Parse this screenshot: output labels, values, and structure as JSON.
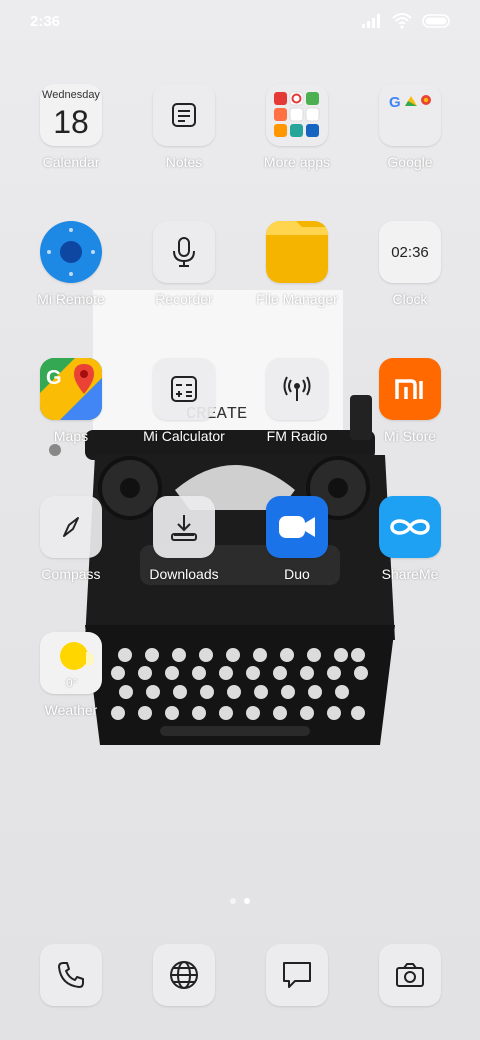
{
  "status_bar": {
    "time": "2:36"
  },
  "apps": {
    "calendar": {
      "label": "Calendar",
      "weekday": "Wednesday",
      "day": "18"
    },
    "notes": {
      "label": "Notes"
    },
    "more_apps": {
      "label": "More apps"
    },
    "google": {
      "label": "Google"
    },
    "mi_remote": {
      "label": "Mi Remote"
    },
    "recorder": {
      "label": "Recorder"
    },
    "file_manager": {
      "label": "File Manager"
    },
    "clock": {
      "label": "Clock",
      "time": "02:36"
    },
    "maps": {
      "label": "Maps"
    },
    "mi_calculator": {
      "label": "Mi Calculator"
    },
    "fm_radio": {
      "label": "FM Radio"
    },
    "mi_store": {
      "label": "Mi Store"
    },
    "compass": {
      "label": "Compass"
    },
    "downloads": {
      "label": "Downloads"
    },
    "duo": {
      "label": "Duo"
    },
    "shareme": {
      "label": "ShareMe"
    },
    "weather": {
      "label": "Weather",
      "temp": "0°"
    }
  },
  "wallpaper": {
    "paper_text": "CREATE"
  },
  "pages": {
    "count": 2,
    "active": 2
  },
  "colors": {
    "file_manager": "#f4b400",
    "mi_store": "#ff6900",
    "duo": "#1a73e8",
    "shareme": "#1ea1f2",
    "mi_remote": "#1e88e5"
  }
}
